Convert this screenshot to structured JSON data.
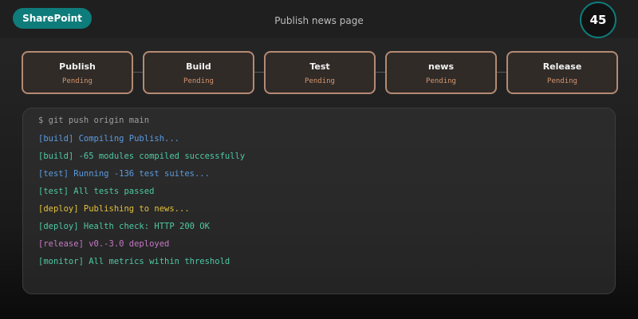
{
  "header": {
    "brand_label": "SharePoint",
    "page_title": "Publish news page",
    "counter_value": "45"
  },
  "pipeline": {
    "stages": [
      {
        "name": "Publish",
        "status": "Pending"
      },
      {
        "name": "Build",
        "status": "Pending"
      },
      {
        "name": "Test",
        "status": "Pending"
      },
      {
        "name": "news",
        "status": "Pending"
      },
      {
        "name": "Release",
        "status": "Pending"
      }
    ]
  },
  "terminal": {
    "lines": [
      {
        "text": "$ git push origin main",
        "kind": "command",
        "color": "#9e9e9e"
      },
      {
        "text": "[build] Compiling Publish...",
        "kind": "build",
        "color": "#5b9be0"
      },
      {
        "text": "[build] -65 modules compiled successfully",
        "kind": "success",
        "color": "#4ec9a3"
      },
      {
        "text": "[test] Running -136 test suites...",
        "kind": "test",
        "color": "#5b9be0"
      },
      {
        "text": "[test] All tests passed",
        "kind": "success",
        "color": "#4ec9a3"
      },
      {
        "text": "[deploy] Publishing to news...",
        "kind": "deploy",
        "color": "#e3c13b"
      },
      {
        "text": "[deploy] Health check: HTTP 200 OK",
        "kind": "success",
        "color": "#4ec9a3"
      },
      {
        "text": "[release] v0.-3.0 deployed",
        "kind": "release",
        "color": "#c678c6"
      },
      {
        "text": "[monitor] All metrics within threshold",
        "kind": "success",
        "color": "#4ec9a3"
      }
    ]
  },
  "colors": {
    "accent": "#0e7c7b",
    "stage_border": "#b48a74",
    "stage_status": "#d4956d"
  }
}
